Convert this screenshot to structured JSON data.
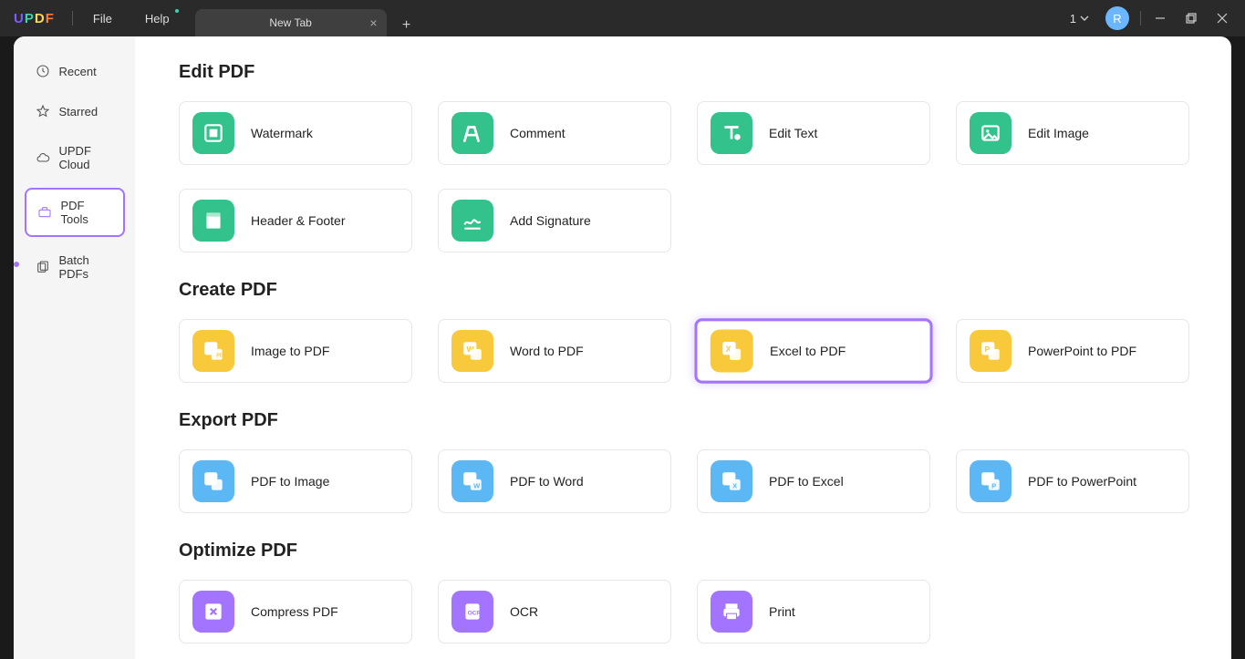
{
  "titlebar": {
    "menu_file": "File",
    "menu_help": "Help",
    "tab_title": "New Tab",
    "count": "1",
    "avatar_letter": "R"
  },
  "sidebar": {
    "items": [
      {
        "label": "Recent"
      },
      {
        "label": "Starred"
      },
      {
        "label": "UPDF Cloud"
      },
      {
        "label": "PDF Tools"
      },
      {
        "label": "Batch PDFs"
      }
    ]
  },
  "sections": {
    "edit_pdf": {
      "title": "Edit PDF",
      "cards": [
        {
          "label": "Watermark"
        },
        {
          "label": "Comment"
        },
        {
          "label": "Edit Text"
        },
        {
          "label": "Edit Image"
        },
        {
          "label": "Header & Footer"
        },
        {
          "label": "Add Signature"
        }
      ]
    },
    "create_pdf": {
      "title": "Create PDF",
      "cards": [
        {
          "label": "Image to PDF"
        },
        {
          "label": "Word to PDF"
        },
        {
          "label": "Excel to PDF"
        },
        {
          "label": "PowerPoint to PDF"
        }
      ]
    },
    "export_pdf": {
      "title": "Export PDF",
      "cards": [
        {
          "label": "PDF to Image"
        },
        {
          "label": "PDF to Word"
        },
        {
          "label": "PDF to Excel"
        },
        {
          "label": "PDF to PowerPoint"
        }
      ]
    },
    "optimize_pdf": {
      "title": "Optimize PDF",
      "cards": [
        {
          "label": "Compress PDF"
        },
        {
          "label": "OCR"
        },
        {
          "label": "Print"
        }
      ]
    }
  }
}
